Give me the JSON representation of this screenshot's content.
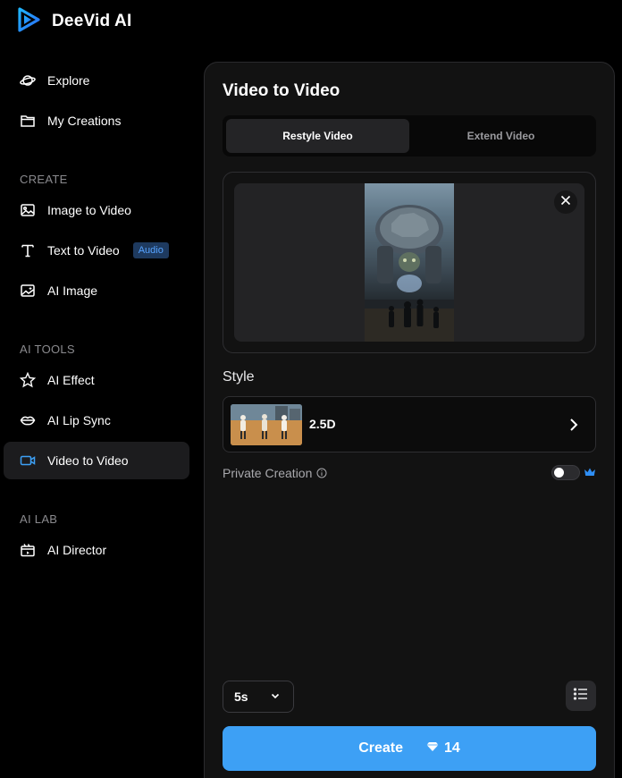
{
  "app": {
    "name": "DeeVid AI"
  },
  "sidebar": {
    "top_items": [
      {
        "label": "Explore",
        "icon": "planet-icon"
      },
      {
        "label": "My Creations",
        "icon": "folder-icon"
      }
    ],
    "sections": [
      {
        "title": "CREATE",
        "items": [
          {
            "label": "Image to Video",
            "icon": "image-icon"
          },
          {
            "label": "Text to Video",
            "icon": "text-icon",
            "badge": "Audio"
          },
          {
            "label": "AI Image",
            "icon": "ai-image-icon"
          }
        ]
      },
      {
        "title": "AI TOOLS",
        "items": [
          {
            "label": "AI Effect",
            "icon": "sparkle-star-icon"
          },
          {
            "label": "AI Lip Sync",
            "icon": "lips-icon"
          },
          {
            "label": "Video to Video",
            "icon": "video-camera-icon",
            "active": true
          }
        ]
      },
      {
        "title": "AI LAB",
        "items": [
          {
            "label": "AI Director",
            "icon": "director-icon"
          }
        ]
      }
    ]
  },
  "panel": {
    "title": "Video to Video",
    "tabs": [
      {
        "label": "Restyle Video",
        "active": true
      },
      {
        "label": "Extend Video",
        "active": false
      }
    ],
    "style": {
      "label": "Style",
      "selected": "2.5D"
    },
    "private_creation": {
      "label": "Private Creation",
      "enabled": false
    },
    "duration": {
      "value": "5s"
    },
    "create": {
      "label": "Create",
      "cost": "14"
    }
  },
  "colors": {
    "accent": "#3da0f5",
    "badge_bg": "#1e3a5f",
    "badge_text": "#56a3ff",
    "crown": "#2f8ef4"
  }
}
